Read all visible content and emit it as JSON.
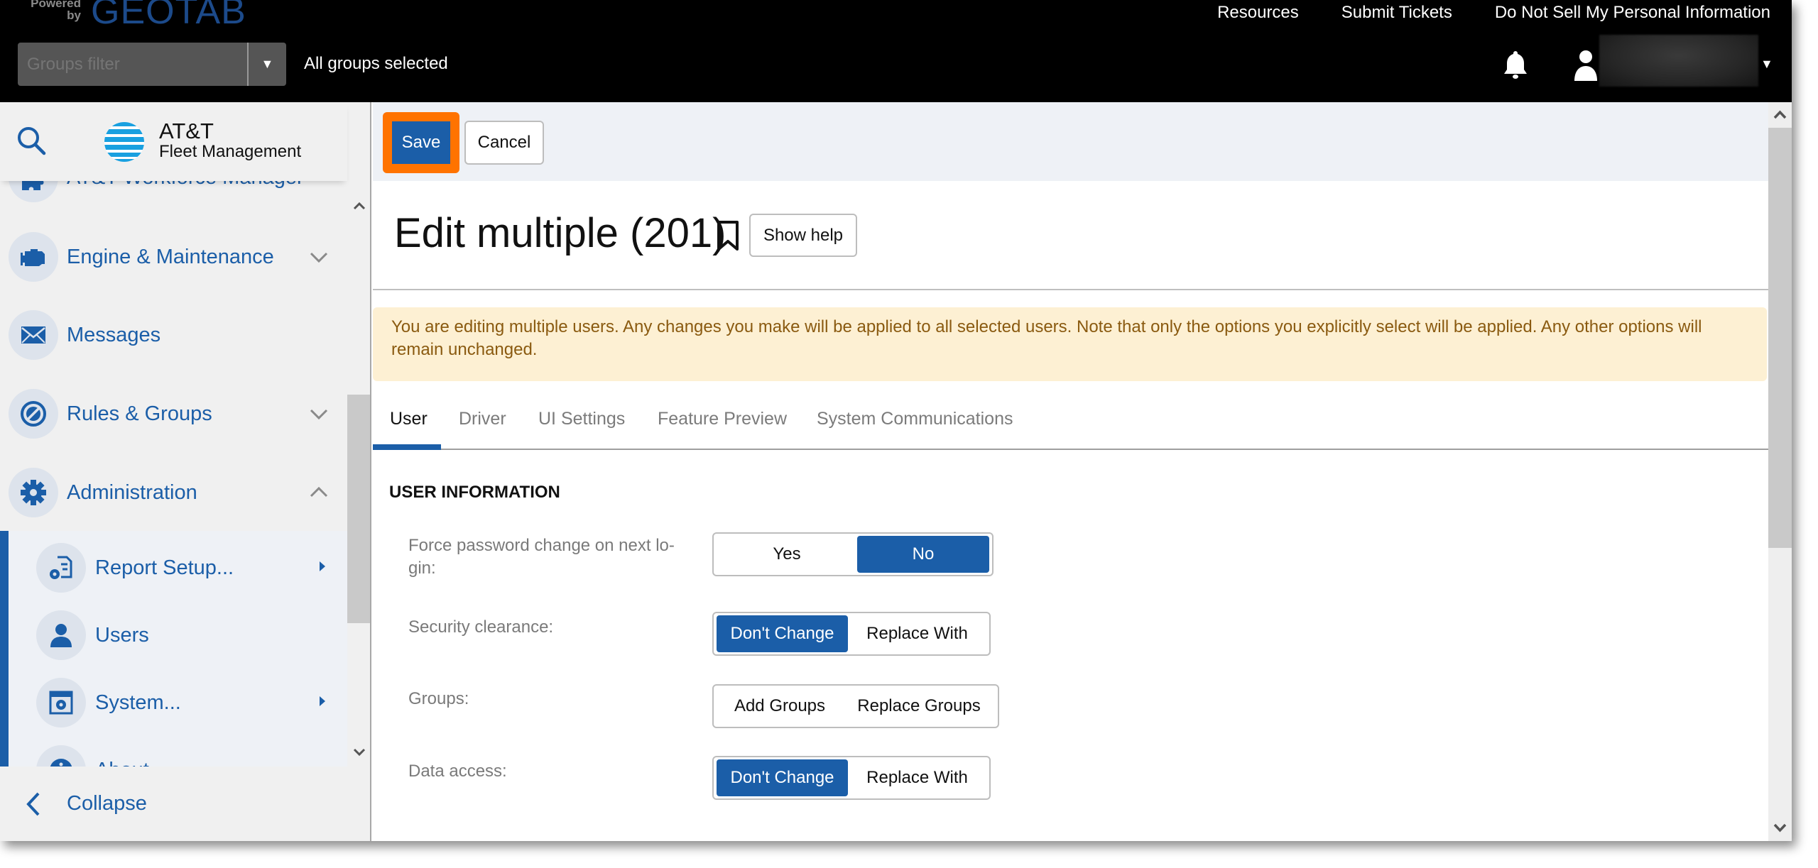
{
  "topbar": {
    "brand_powered": "Powered by",
    "brand_name": "GEOTAB",
    "links": [
      "Resources",
      "Submit Tickets",
      "Do Not Sell My Personal Information"
    ],
    "groups_filter_placeholder": "Groups filter",
    "groups_status": "All groups selected",
    "user_name_redacted": ""
  },
  "sidebar": {
    "logo_title": "AT&T",
    "logo_subtitle": "Fleet Management",
    "items": [
      {
        "label": "AT&T Workforce Manager",
        "icon": "puzzle-icon"
      },
      {
        "label": "Engine & Maintenance",
        "icon": "engine-icon",
        "chevron": "down"
      },
      {
        "label": "Messages",
        "icon": "envelope-icon"
      },
      {
        "label": "Rules & Groups",
        "icon": "rules-icon",
        "chevron": "down"
      },
      {
        "label": "Administration",
        "icon": "gear-icon",
        "chevron": "up",
        "expanded": true
      }
    ],
    "submenu": [
      {
        "label": "Report Setup...",
        "icon": "report-setup-icon",
        "has_submenu": true
      },
      {
        "label": "Users",
        "icon": "user-icon",
        "has_submenu": false
      },
      {
        "label": "System...",
        "icon": "system-icon",
        "has_submenu": true
      },
      {
        "label": "About",
        "icon": "info-icon",
        "has_submenu": false
      }
    ],
    "collapse_label": "Collapse"
  },
  "main": {
    "save_label": "Save",
    "cancel_label": "Cancel",
    "title": "Edit multiple (201)",
    "show_help_label": "Show help",
    "warning": "You are editing multiple users. Any changes you make will be applied to all selected users. Note that only the options you explicitly select will be applied. Any other options will remain unchanged.",
    "tabs": [
      {
        "label": "User",
        "active": true
      },
      {
        "label": "Driver",
        "active": false
      },
      {
        "label": "UI Settings",
        "active": false
      },
      {
        "label": "Feature Preview",
        "active": false
      },
      {
        "label": "System Communications",
        "active": false
      }
    ],
    "section_title": "USER INFORMATION",
    "fields": [
      {
        "label": "Force password change on next lo-gin:",
        "options": [
          "Yes",
          "No"
        ],
        "selected": "No"
      },
      {
        "label": "Security clearance:",
        "options": [
          "Don't Change",
          "Replace With"
        ],
        "selected": "Don't Change"
      },
      {
        "label": "Groups:",
        "options": [
          "Add Groups",
          "Replace Groups"
        ],
        "selected": null
      },
      {
        "label": "Data access:",
        "options": [
          "Don't Change",
          "Replace With"
        ],
        "selected": "Don't Change"
      }
    ]
  },
  "colors": {
    "accent": "#1b5ea8",
    "highlight": "#ff7300",
    "warning_bg": "#fdf0d3",
    "warning_text": "#8a5a10",
    "topbar_bg": "#000000"
  }
}
